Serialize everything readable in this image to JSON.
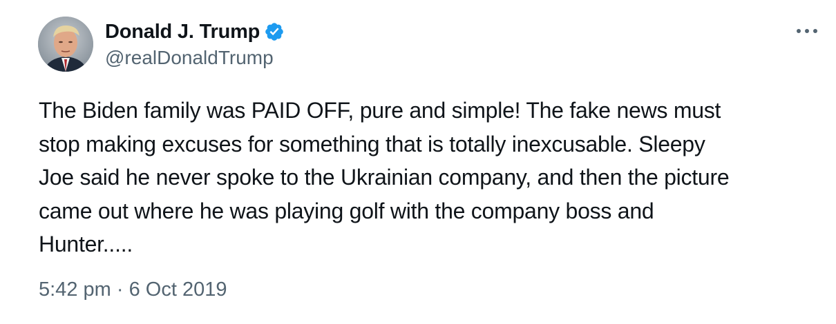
{
  "author": {
    "display_name": "Donald J. Trump",
    "handle": "@realDonaldTrump",
    "verified": true,
    "avatar_icon": "profile-avatar"
  },
  "menu": {
    "icon": "more-horizontal-icon",
    "label": "•••"
  },
  "tweet": {
    "lines": [
      "The Biden family was PAID OFF, pure and simple! The fake news must",
      "stop making excuses for something that is totally inexcusable. Sleepy",
      "Joe said he never spoke to the Ukrainian company, and then the picture",
      "came out where he was playing golf with the company boss and",
      "Hunter....."
    ]
  },
  "meta": {
    "time": "5:42 pm",
    "separator": "·",
    "date": "6 Oct 2019"
  },
  "colors": {
    "text": "#0f1419",
    "secondary": "#536471",
    "verified_badge": "#1d9bf0",
    "background": "#ffffff"
  }
}
